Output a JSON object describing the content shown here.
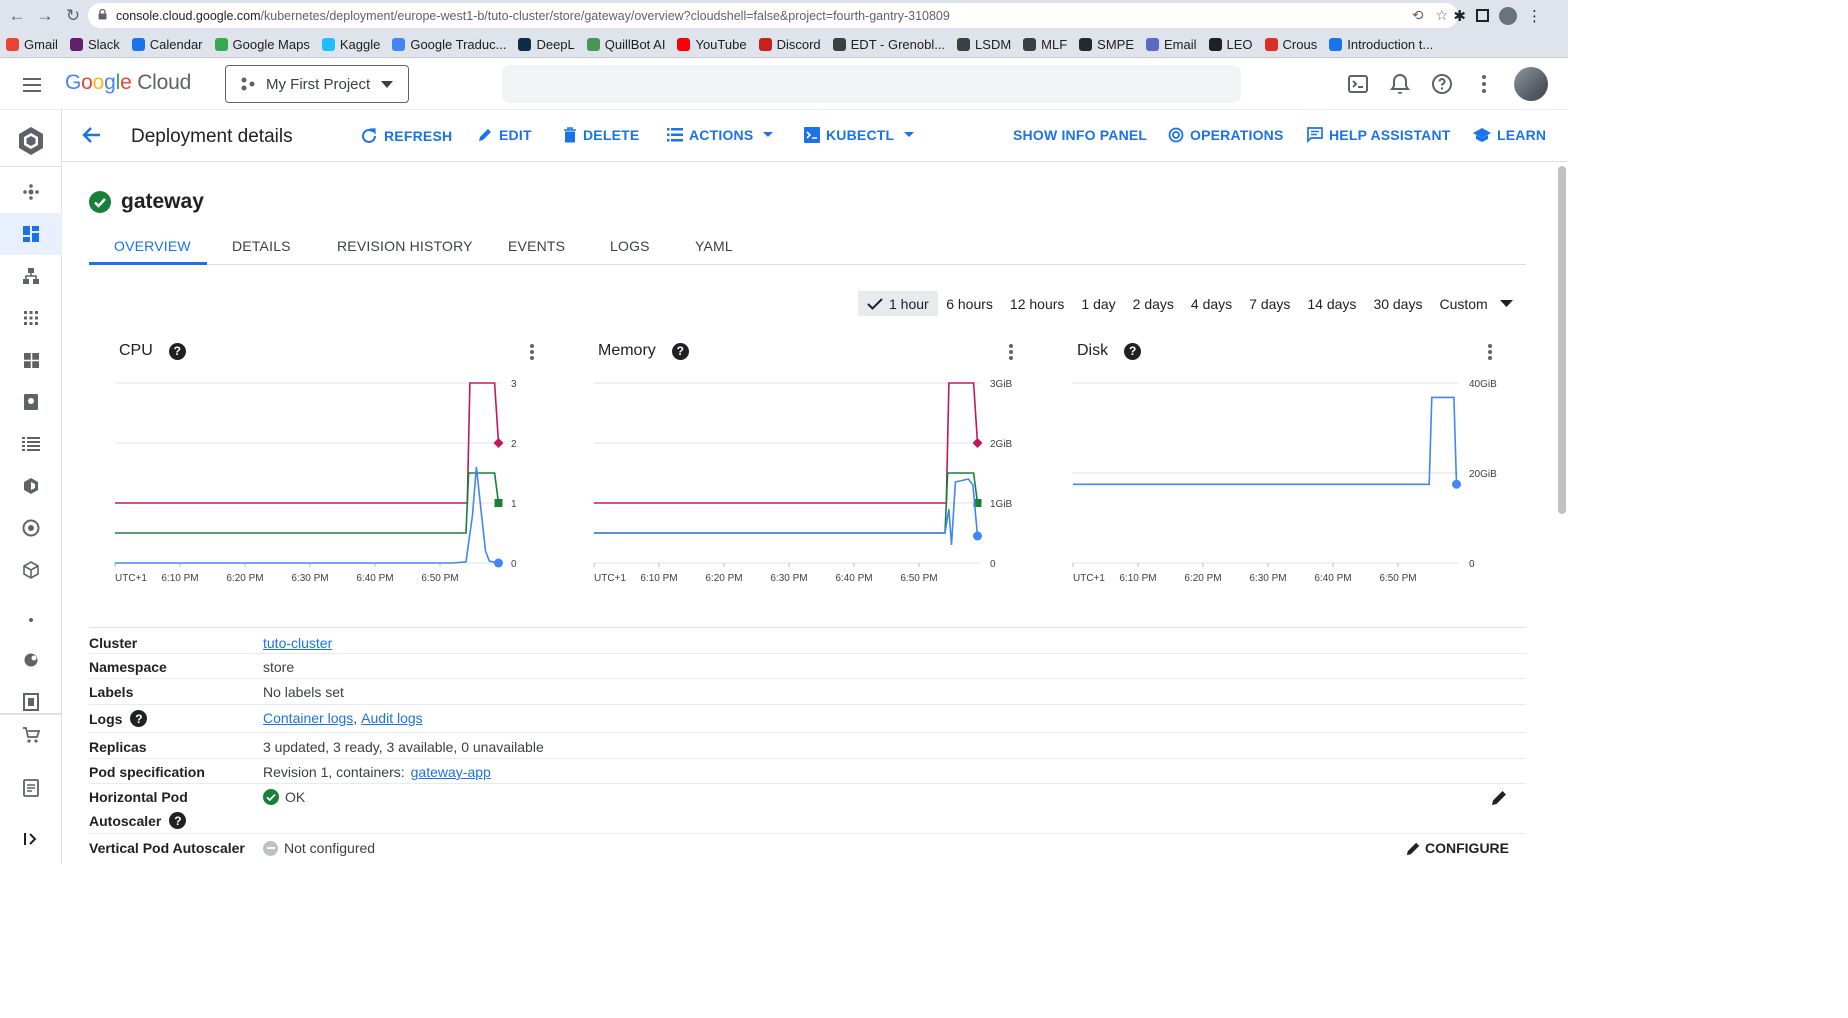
{
  "browser": {
    "url_host": "console.cloud.google.com",
    "url_path": "/kubernetes/deployment/europe-west1-b/tuto-cluster/store/gateway/overview?cloudshell=false&project=fourth-gantry-310809",
    "bookmarks": [
      {
        "label": "Gmail",
        "icon": "gmail-icon",
        "color": "#ea4335"
      },
      {
        "label": "Slack",
        "icon": "slack-icon",
        "color": "#611f69"
      },
      {
        "label": "Calendar",
        "icon": "calendar-icon",
        "color": "#1a73e8"
      },
      {
        "label": "Google Maps",
        "icon": "maps-icon",
        "color": "#34a853"
      },
      {
        "label": "Kaggle",
        "icon": "kaggle-icon",
        "color": "#20beff"
      },
      {
        "label": "Google Traduc...",
        "icon": "translate-icon",
        "color": "#4285f4"
      },
      {
        "label": "DeepL",
        "icon": "deepl-icon",
        "color": "#0f2b46"
      },
      {
        "label": "QuillBot AI",
        "icon": "quillbot-icon",
        "color": "#499557"
      },
      {
        "label": "YouTube",
        "icon": "youtube-icon",
        "color": "#ff0000"
      },
      {
        "label": "Discord",
        "icon": "discord-icon",
        "color": "#c5221f"
      },
      {
        "label": "EDT - Grenobl...",
        "icon": "globe-icon",
        "color": "#3c4043"
      },
      {
        "label": "LSDM",
        "icon": "globe-icon",
        "color": "#3c4043"
      },
      {
        "label": "MLF",
        "icon": "globe-icon",
        "color": "#3c4043"
      },
      {
        "label": "SMPE",
        "icon": "github-icon",
        "color": "#24292f"
      },
      {
        "label": "Email",
        "icon": "email-icon",
        "color": "#5c6bc0"
      },
      {
        "label": "LEO",
        "icon": "leo-icon",
        "color": "#202124"
      },
      {
        "label": "Crous",
        "icon": "crous-icon",
        "color": "#d93025"
      },
      {
        "label": "Introduction t...",
        "icon": "intro-icon",
        "color": "#1a73e8"
      }
    ]
  },
  "header": {
    "logo_google": "Google",
    "logo_cloud": "Cloud",
    "project": "My First Project"
  },
  "toolbar": {
    "title": "Deployment details",
    "refresh": "REFRESH",
    "edit": "EDIT",
    "delete": "DELETE",
    "actions": "ACTIONS",
    "kubectl": "KUBECTL",
    "show_info_panel": "SHOW INFO PANEL",
    "operations": "OPERATIONS",
    "help_assistant": "HELP ASSISTANT",
    "learn": "LEARN"
  },
  "resource": {
    "name": "gateway",
    "tabs": [
      "OVERVIEW",
      "DETAILS",
      "REVISION HISTORY",
      "EVENTS",
      "LOGS",
      "YAML"
    ],
    "active_tab": "OVERVIEW"
  },
  "time_range": {
    "options": [
      "1 hour",
      "6 hours",
      "12 hours",
      "1 day",
      "2 days",
      "4 days",
      "7 days",
      "14 days",
      "30 days"
    ],
    "selected": "1 hour",
    "custom": "Custom"
  },
  "colors": {
    "limit": "#c2185b",
    "request": "#188038",
    "usage": "#4285f4",
    "accent": "#1a73e8"
  },
  "chart_data": [
    {
      "type": "line",
      "title": "CPU",
      "x_ticks": [
        "UTC+1",
        "6:10 PM",
        "6:20 PM",
        "6:30 PM",
        "6:40 PM",
        "6:50 PM"
      ],
      "y_ticks": [
        "3",
        "2",
        "1",
        "0"
      ],
      "ylim": [
        0,
        3
      ],
      "x_domain": [
        0,
        60
      ],
      "series": [
        {
          "color": "#c2185b",
          "x": [
            0,
            54.2,
            54.6,
            58.4,
            59
          ],
          "y": [
            1,
            1,
            3,
            3,
            2
          ],
          "end_marker": "diamond"
        },
        {
          "color": "#188038",
          "x": [
            0,
            54,
            54.4,
            58.4,
            59
          ],
          "y": [
            0.5,
            0.5,
            1.5,
            1.5,
            1
          ],
          "end_marker": "square"
        },
        {
          "color": "#4285f4",
          "x": [
            0,
            52,
            54,
            55,
            55.6,
            56.3,
            57,
            57.6,
            59
          ],
          "y": [
            0,
            0,
            0.02,
            0.8,
            1.6,
            0.9,
            0.2,
            0.03,
            0
          ],
          "end_marker": "circle"
        }
      ]
    },
    {
      "type": "line",
      "title": "Memory",
      "x_ticks": [
        "UTC+1",
        "6:10 PM",
        "6:20 PM",
        "6:30 PM",
        "6:40 PM",
        "6:50 PM"
      ],
      "y_ticks": [
        "3GiB",
        "2GiB",
        "1GiB",
        "0"
      ],
      "ylim": [
        0,
        3
      ],
      "x_domain": [
        0,
        60
      ],
      "series": [
        {
          "color": "#c2185b",
          "x": [
            0,
            54.2,
            54.6,
            58.4,
            59
          ],
          "y": [
            1,
            1,
            3,
            3,
            2
          ],
          "end_marker": "diamond"
        },
        {
          "color": "#188038",
          "x": [
            0,
            54,
            54.4,
            58.4,
            59
          ],
          "y": [
            0.5,
            0.5,
            1.5,
            1.5,
            1
          ],
          "end_marker": "square"
        },
        {
          "color": "#4285f4",
          "x": [
            0,
            54,
            54.6,
            55,
            55.6,
            57.6,
            58.3,
            59
          ],
          "y": [
            0.5,
            0.5,
            0.9,
            0.3,
            1.35,
            1.4,
            1.3,
            0.45
          ],
          "end_marker": "circle"
        }
      ]
    },
    {
      "type": "line",
      "title": "Disk",
      "x_ticks": [
        "UTC+1",
        "6:10 PM",
        "6:20 PM",
        "6:30 PM",
        "6:40 PM",
        "6:50 PM"
      ],
      "y_ticks": [
        "40GiB",
        "20GiB",
        "0"
      ],
      "ylim": [
        0,
        40
      ],
      "x_domain": [
        0,
        60
      ],
      "series": [
        {
          "color": "#4285f4",
          "x": [
            0,
            54.8,
            55.2,
            58.6,
            59
          ],
          "y": [
            17.5,
            17.5,
            36.8,
            36.8,
            17.5
          ],
          "end_marker": "circle"
        }
      ]
    }
  ],
  "info": {
    "cluster_label": "Cluster",
    "cluster_value": "tuto-cluster",
    "namespace_label": "Namespace",
    "namespace_value": "store",
    "labels_label": "Labels",
    "labels_value": "No labels set",
    "logs_label": "Logs",
    "logs_container": "Container logs",
    "logs_sep": ",",
    "logs_audit": "Audit logs",
    "replicas_label": "Replicas",
    "replicas_value": "3 updated, 3 ready, 3 available, 0 unavailable",
    "podspec_label": "Pod specification",
    "podspec_prefix": "Revision 1, containers:",
    "podspec_container": "gateway-app",
    "hpa_label_1": "Horizontal Pod",
    "hpa_label_2": "Autoscaler",
    "hpa_value": "OK",
    "vpa_label": "Vertical Pod Autoscaler",
    "vpa_value": "Not configured",
    "configure": "CONFIGURE"
  }
}
